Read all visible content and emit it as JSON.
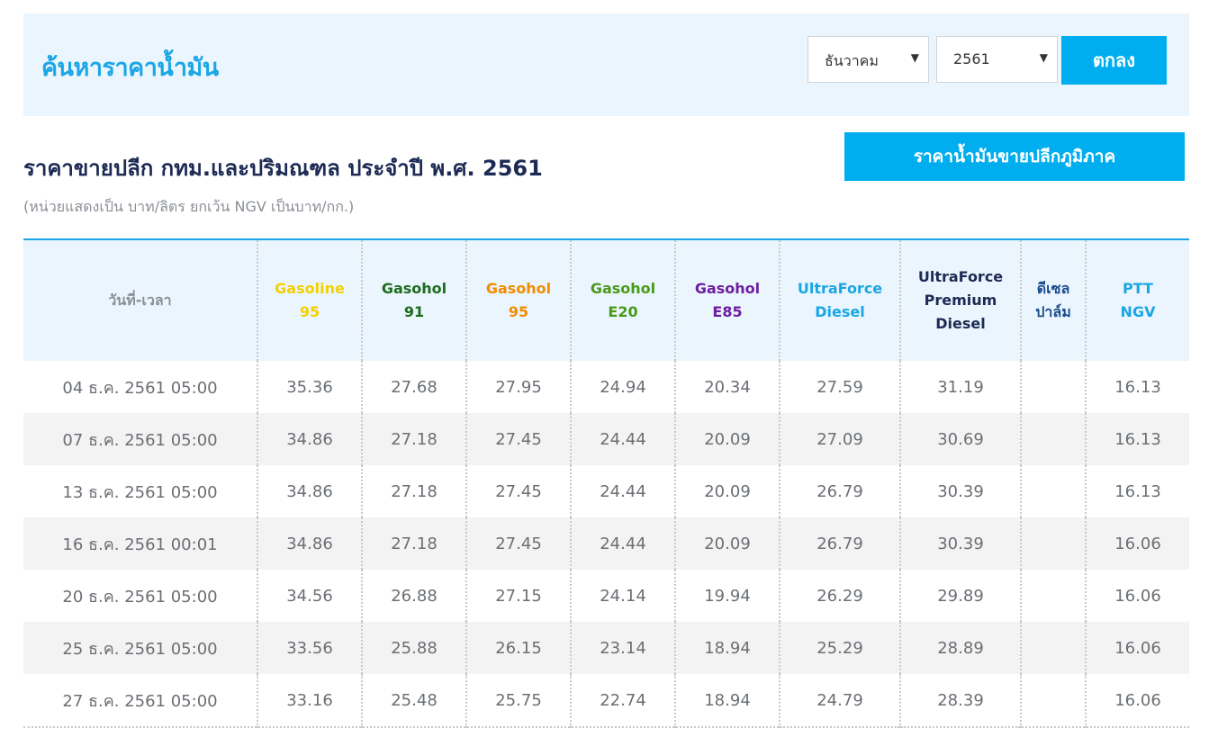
{
  "search": {
    "title": "ค้นหาราคาน้ำมัน",
    "month": "ธันวาคม",
    "year": "2561",
    "submit_label": "ตกลง"
  },
  "section": {
    "title": "ราคาขายปลีก กทม.และปริมณฑล ประจำปี พ.ศ. 2561",
    "unit_note": "(หน่วยแสดงเป็น บาท/ลิตร ยกเว้น NGV เป็นบาท/กก.)",
    "region_button": "ราคาน้ำมันขายปลีกภูมิภาค"
  },
  "table": {
    "columns": [
      {
        "lines": [
          "วันที่-เวลา"
        ],
        "color": "#8a8f96"
      },
      {
        "lines": [
          "Gasoline",
          "95"
        ],
        "color": "#f5d000"
      },
      {
        "lines": [
          "Gasohol",
          "91"
        ],
        "color": "#1d6b1d"
      },
      {
        "lines": [
          "Gasohol",
          "95"
        ],
        "color": "#f28c00"
      },
      {
        "lines": [
          "Gasohol",
          "E20"
        ],
        "color": "#4a9a1a"
      },
      {
        "lines": [
          "Gasohol",
          "E85"
        ],
        "color": "#6e1ea0"
      },
      {
        "lines": [
          "UltraForce",
          "Diesel"
        ],
        "color": "#1aa6e5"
      },
      {
        "lines": [
          "UltraForce",
          "Premium",
          "Diesel"
        ],
        "color": "#1c2a54"
      },
      {
        "lines": [
          "ดีเซล",
          "ปาล์ม"
        ],
        "color": "#1a4c8e"
      },
      {
        "lines": [
          "PTT",
          "NGV"
        ],
        "color": "#1aa6e5"
      }
    ],
    "rows": [
      [
        "04 ธ.ค. 2561 05:00",
        "35.36",
        "27.68",
        "27.95",
        "24.94",
        "20.34",
        "27.59",
        "31.19",
        "",
        "16.13"
      ],
      [
        "07 ธ.ค. 2561 05:00",
        "34.86",
        "27.18",
        "27.45",
        "24.44",
        "20.09",
        "27.09",
        "30.69",
        "",
        "16.13"
      ],
      [
        "13 ธ.ค. 2561 05:00",
        "34.86",
        "27.18",
        "27.45",
        "24.44",
        "20.09",
        "26.79",
        "30.39",
        "",
        "16.13"
      ],
      [
        "16 ธ.ค. 2561 00:01",
        "34.86",
        "27.18",
        "27.45",
        "24.44",
        "20.09",
        "26.79",
        "30.39",
        "",
        "16.06"
      ],
      [
        "20 ธ.ค. 2561 05:00",
        "34.56",
        "26.88",
        "27.15",
        "24.14",
        "19.94",
        "26.29",
        "29.89",
        "",
        "16.06"
      ],
      [
        "25 ธ.ค. 2561 05:00",
        "33.56",
        "25.88",
        "26.15",
        "23.14",
        "18.94",
        "25.29",
        "28.89",
        "",
        "16.06"
      ],
      [
        "27 ธ.ค. 2561 05:00",
        "33.16",
        "25.48",
        "25.75",
        "22.74",
        "18.94",
        "24.79",
        "28.39",
        "",
        "16.06"
      ]
    ]
  }
}
